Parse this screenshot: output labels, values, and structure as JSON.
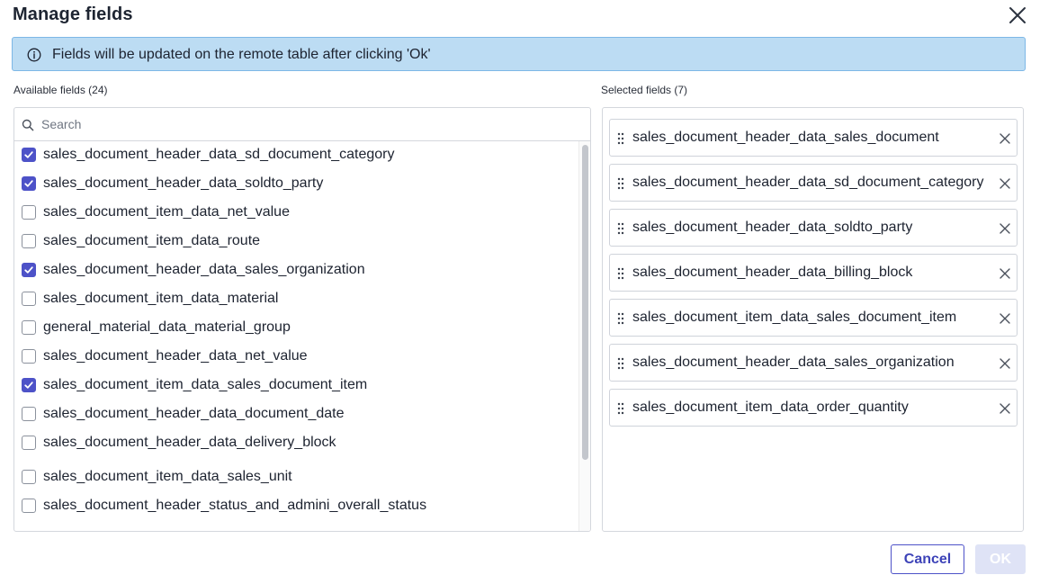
{
  "dialog": {
    "title": "Manage fields",
    "close_icon": "close-icon"
  },
  "banner": {
    "icon": "info-icon",
    "message": "Fields will be updated on the remote table after clicking 'Ok'",
    "background": "#bcdcf3"
  },
  "available": {
    "label": "Available fields (24)",
    "search_placeholder": "Search",
    "items": [
      {
        "label": "sales_document_header_data_sd_document_category",
        "checked": true
      },
      {
        "label": "sales_document_header_data_soldto_party",
        "checked": true
      },
      {
        "label": "sales_document_item_data_net_value",
        "checked": false
      },
      {
        "label": "sales_document_item_data_route",
        "checked": false
      },
      {
        "label": "sales_document_header_data_sales_organization",
        "checked": true
      },
      {
        "label": "sales_document_item_data_material",
        "checked": false
      },
      {
        "label": "general_material_data_material_group",
        "checked": false
      },
      {
        "label": "sales_document_header_data_net_value",
        "checked": false
      },
      {
        "label": "sales_document_item_data_sales_document_item",
        "checked": true
      },
      {
        "label": "sales_document_header_data_document_date",
        "checked": false
      },
      {
        "label": "sales_document_header_data_delivery_block",
        "checked": false
      },
      {
        "label": "sales_document_item_data_sales_unit",
        "checked": false
      },
      {
        "label": "sales_document_header_status_and_admini_overall_status",
        "checked": false
      }
    ]
  },
  "selected": {
    "label": "Selected fields (7)",
    "items": [
      "sales_document_header_data_sales_document",
      "sales_document_header_data_sd_document_category",
      "sales_document_header_data_soldto_party",
      "sales_document_header_data_billing_block",
      "sales_document_item_data_sales_document_item",
      "sales_document_header_data_sales_organization",
      "sales_document_item_data_order_quantity"
    ]
  },
  "footer": {
    "cancel_label": "Cancel",
    "ok_label": "OK",
    "accent": "#4d52c8"
  }
}
